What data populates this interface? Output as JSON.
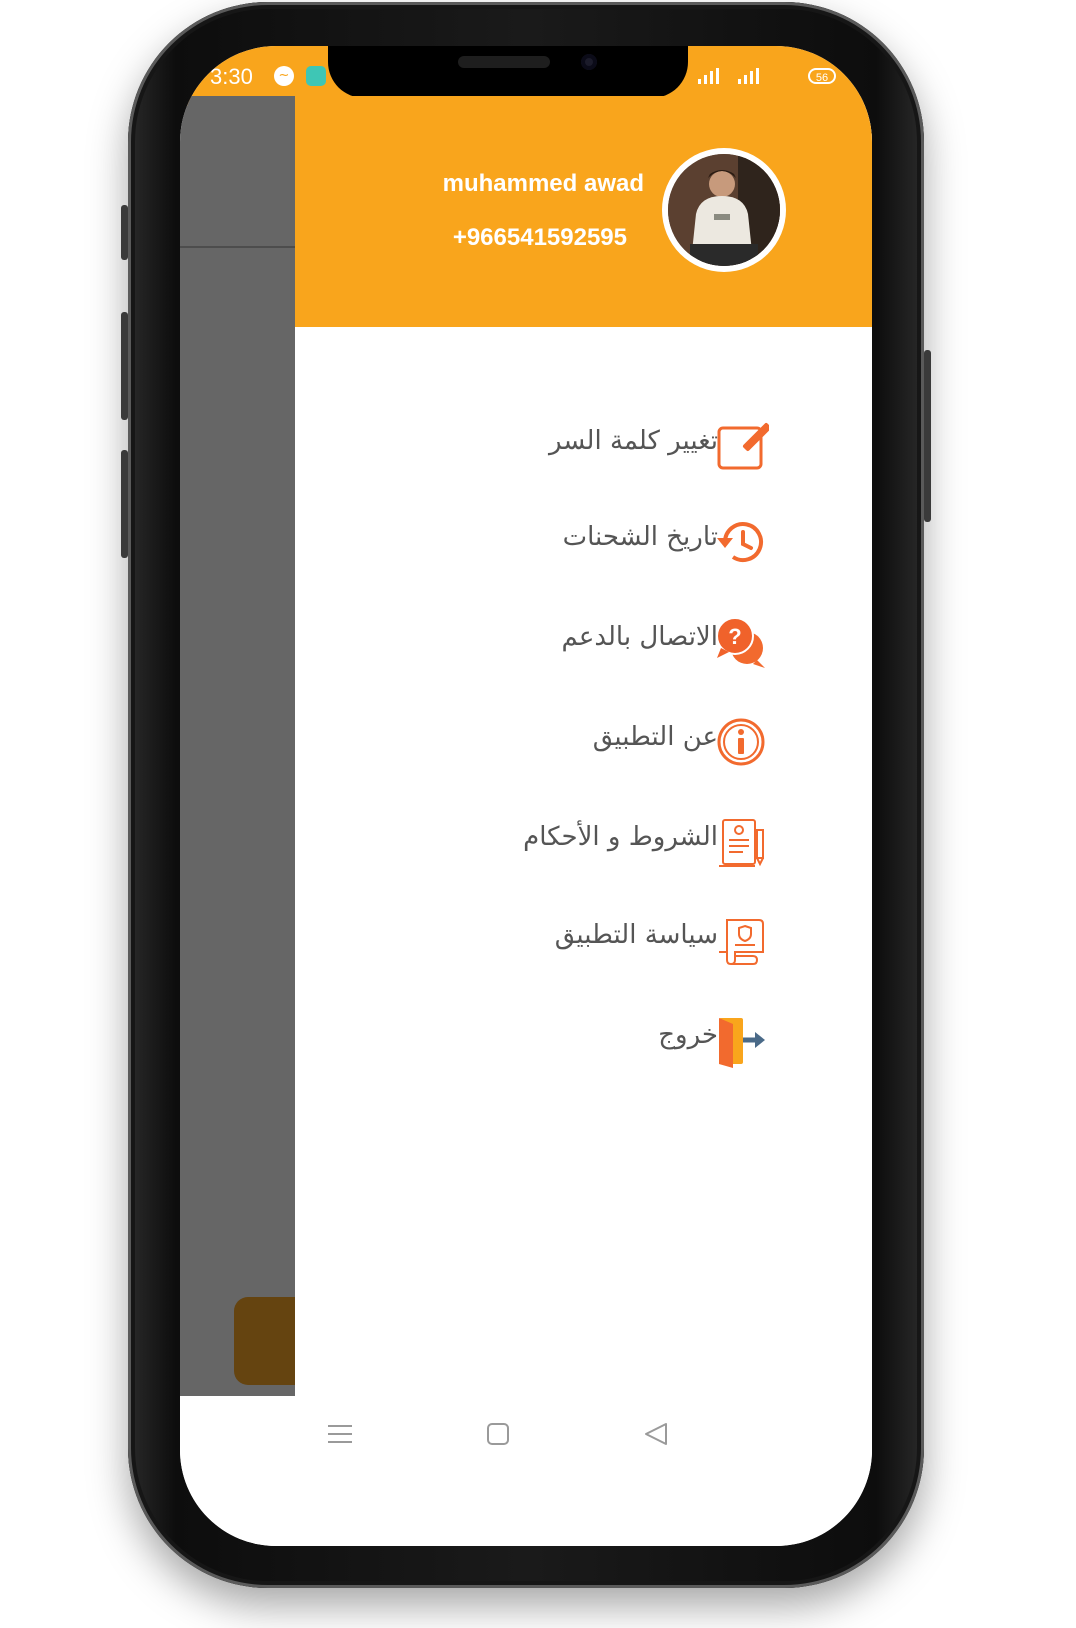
{
  "status_bar": {
    "time": "3:30",
    "battery": "56",
    "icons": [
      "messenger-icon",
      "app-notification-icon",
      "signal-icon",
      "signal-icon",
      "battery-icon"
    ]
  },
  "drawer": {
    "user_name": "muhammed awad",
    "user_phone": "+966541592595",
    "items": [
      {
        "label": "تغيير كلمة السر",
        "icon": "edit-icon"
      },
      {
        "label": "تاريخ الشحنات",
        "icon": "history-icon"
      },
      {
        "label": "الاتصال بالدعم",
        "icon": "support-chat-icon"
      },
      {
        "label": "عن التطبيق",
        "icon": "info-icon"
      },
      {
        "label": "الشروط و الأحكام",
        "icon": "terms-document-icon"
      },
      {
        "label": "سياسة التطبيق",
        "icon": "policy-scroll-icon"
      },
      {
        "label": "خروج",
        "icon": "logout-icon"
      }
    ]
  },
  "navbar": {
    "icons": [
      "menu-icon",
      "home-square-icon",
      "back-triangle-icon"
    ]
  },
  "colors": {
    "accent": "#F9A51C",
    "icon_orange": "#F26A2E",
    "text": "#555555",
    "scrim": "#666666"
  }
}
